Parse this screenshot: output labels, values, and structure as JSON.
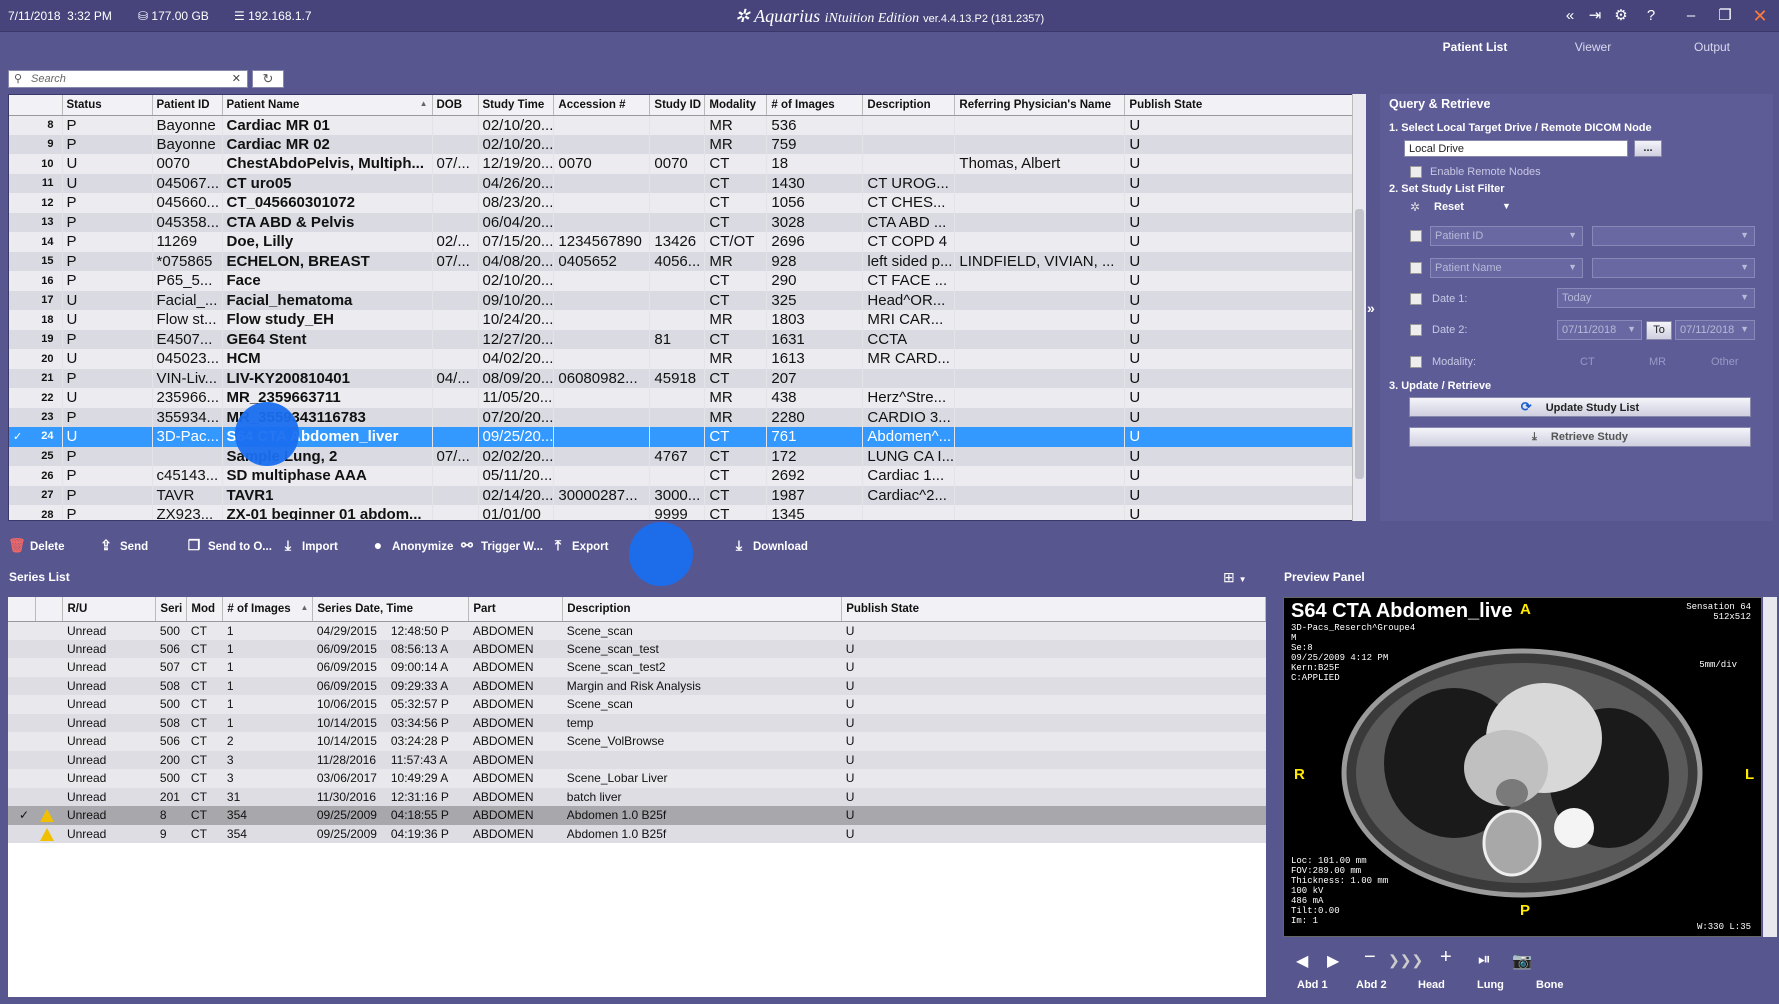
{
  "titlebar": {
    "date": "7/11/2018",
    "time": "3:32 PM",
    "disk": "177.00 GB",
    "ip": "192.168.1.7",
    "app_name": "Aquarius",
    "app_sub": "iNtuition Edition",
    "version": "ver.4.4.13.P2 (181.2357)"
  },
  "nav": {
    "tabs": [
      "Patient List",
      "Viewer",
      "Output"
    ],
    "active": "Patient List"
  },
  "search": {
    "placeholder": "Search"
  },
  "study_table": {
    "columns": [
      "Status",
      "Patient ID",
      "Patient Name",
      "DOB",
      "Study Time",
      "Accession #",
      "Study ID",
      "Modality",
      "# of Images",
      "Description",
      "Referring Physician's Name",
      "Publish State"
    ],
    "rows": [
      {
        "n": "8",
        "status": "P",
        "pid": "Bayonne",
        "name": "Cardiac MR 01",
        "dob": "",
        "time": "02/10/20...",
        "acc": "",
        "sid": "",
        "mod": "MR",
        "img": "536",
        "desc": "",
        "ref": "",
        "pub": "U"
      },
      {
        "n": "9",
        "status": "P",
        "pid": "Bayonne",
        "name": "Cardiac MR 02",
        "dob": "",
        "time": "02/10/20...",
        "acc": "",
        "sid": "",
        "mod": "MR",
        "img": "759",
        "desc": "",
        "ref": "",
        "pub": "U"
      },
      {
        "n": "10",
        "status": "U",
        "pid": "0070",
        "name": "ChestAbdoPelvis, Multiph...",
        "dob": "07/...",
        "time": "12/19/20...",
        "acc": "0070",
        "sid": "0070",
        "mod": "CT",
        "img": "18",
        "desc": "",
        "ref": "Thomas, Albert",
        "pub": "U"
      },
      {
        "n": "11",
        "status": "U",
        "pid": "045067...",
        "name": "CT uro05",
        "dob": "",
        "time": "04/26/20...",
        "acc": "",
        "sid": "",
        "mod": "CT",
        "img": "1430",
        "desc": "CT UROG...",
        "ref": "",
        "pub": "U"
      },
      {
        "n": "12",
        "status": "P",
        "pid": "045660...",
        "name": "CT_045660301072",
        "dob": "",
        "time": "08/23/20...",
        "acc": "",
        "sid": "",
        "mod": "CT",
        "img": "1056",
        "desc": "CT CHES...",
        "ref": "",
        "pub": "U"
      },
      {
        "n": "13",
        "status": "P",
        "pid": "045358...",
        "name": "CTA ABD & Pelvis",
        "dob": "",
        "time": "06/04/20...",
        "acc": "",
        "sid": "",
        "mod": "CT",
        "img": "3028",
        "desc": "CTA ABD ...",
        "ref": "",
        "pub": "U"
      },
      {
        "n": "14",
        "status": "P",
        "pid": "11269",
        "name": "Doe, Lilly",
        "dob": "02/...",
        "time": "07/15/20...",
        "acc": "1234567890",
        "sid": "13426",
        "mod": "CT/OT",
        "img": "2696",
        "desc": "CT COPD 4",
        "ref": "",
        "pub": "U"
      },
      {
        "n": "15",
        "status": "P",
        "pid": "*075865",
        "name": "ECHELON, BREAST",
        "dob": "07/...",
        "time": "04/08/20...",
        "acc": "0405652",
        "sid": "4056...",
        "mod": "MR",
        "img": "928",
        "desc": "left sided p...",
        "ref": "LINDFIELD, VIVIAN, ...",
        "pub": "U"
      },
      {
        "n": "16",
        "status": "P",
        "pid": "P65_5...",
        "name": "Face",
        "dob": "",
        "time": "02/10/20...",
        "acc": "",
        "sid": "",
        "mod": "CT",
        "img": "290",
        "desc": "CT FACE ...",
        "ref": "",
        "pub": "U"
      },
      {
        "n": "17",
        "status": "U",
        "pid": "Facial_...",
        "name": "Facial_hematoma",
        "dob": "",
        "time": "09/10/20...",
        "acc": "",
        "sid": "",
        "mod": "CT",
        "img": "325",
        "desc": "Head^OR...",
        "ref": "",
        "pub": "U"
      },
      {
        "n": "18",
        "status": "U",
        "pid": "Flow st...",
        "name": "Flow study_EH",
        "dob": "",
        "time": "10/24/20...",
        "acc": "",
        "sid": "",
        "mod": "MR",
        "img": "1803",
        "desc": "MRI CAR...",
        "ref": "",
        "pub": "U"
      },
      {
        "n": "19",
        "status": "P",
        "pid": "E4507...",
        "name": "GE64 Stent",
        "dob": "",
        "time": "12/27/20...",
        "acc": "",
        "sid": "81",
        "mod": "CT",
        "img": "1631",
        "desc": "CCTA",
        "ref": "",
        "pub": "U"
      },
      {
        "n": "20",
        "status": "U",
        "pid": "045023...",
        "name": "HCM",
        "dob": "",
        "time": "04/02/20...",
        "acc": "",
        "sid": "",
        "mod": "MR",
        "img": "1613",
        "desc": "MR CARD...",
        "ref": "",
        "pub": "U"
      },
      {
        "n": "21",
        "status": "P",
        "pid": "VIN-Liv...",
        "name": "LIV-KY200810401",
        "dob": "04/...",
        "time": "08/09/20...",
        "acc": "06080982...",
        "sid": "45918",
        "mod": "CT",
        "img": "207",
        "desc": "",
        "ref": "",
        "pub": "U"
      },
      {
        "n": "22",
        "status": "U",
        "pid": "235966...",
        "name": "MR_2359663711",
        "dob": "",
        "time": "11/05/20...",
        "acc": "",
        "sid": "",
        "mod": "MR",
        "img": "438",
        "desc": "Herz^Stre...",
        "ref": "",
        "pub": "U"
      },
      {
        "n": "23",
        "status": "P",
        "pid": "355934...",
        "name": "MR_3559343116783",
        "dob": "",
        "time": "07/20/20...",
        "acc": "",
        "sid": "",
        "mod": "MR",
        "img": "2280",
        "desc": "CARDIO 3...",
        "ref": "",
        "pub": "U"
      },
      {
        "n": "24",
        "status": "U",
        "pid": "3D-Pac...",
        "name": "S64 CTA Abdomen_liver",
        "dob": "",
        "time": "09/25/20...",
        "acc": "",
        "sid": "",
        "mod": "CT",
        "img": "761",
        "desc": "Abdomen^...",
        "ref": "",
        "pub": "U",
        "selected": true
      },
      {
        "n": "25",
        "status": "P",
        "pid": "",
        "name": "Sample Lung, 2",
        "dob": "07/...",
        "time": "02/02/20...",
        "acc": "",
        "sid": "4767",
        "mod": "CT",
        "img": "172",
        "desc": "LUNG CA I...",
        "ref": "",
        "pub": "U"
      },
      {
        "n": "26",
        "status": "P",
        "pid": "c45143...",
        "name": "SD multiphase AAA",
        "dob": "",
        "time": "05/11/20...",
        "acc": "",
        "sid": "",
        "mod": "CT",
        "img": "2692",
        "desc": "Cardiac 1...",
        "ref": "",
        "pub": "U"
      },
      {
        "n": "27",
        "status": "P",
        "pid": "TAVR",
        "name": "TAVR1",
        "dob": "",
        "time": "02/14/20...",
        "acc": "30000287...",
        "sid": "3000...",
        "mod": "CT",
        "img": "1987",
        "desc": "Cardiac^2...",
        "ref": "",
        "pub": "U"
      },
      {
        "n": "28",
        "status": "P",
        "pid": "ZX923...",
        "name": "ZX-01 beginner 01 abdom...",
        "dob": "",
        "time": "01/01/00",
        "acc": "",
        "sid": "9999",
        "mod": "CT",
        "img": "1345",
        "desc": "",
        "ref": "",
        "pub": "U"
      }
    ]
  },
  "toolbar": {
    "delete": "Delete",
    "send": "Send",
    "send_to": "Send to O...",
    "import": "Import",
    "anonymize": "Anonymize",
    "trigger": "Trigger W...",
    "export": "Export",
    "download": "Download"
  },
  "series": {
    "title": "Series List",
    "columns": [
      "R/U",
      "Seri",
      "Mod",
      "# of Images",
      "Series Date, Time",
      "Part",
      "Description",
      "Publish State"
    ],
    "rows": [
      {
        "ru": "Unread",
        "seri": "500",
        "mod": "CT",
        "img": "1",
        "date": "04/29/2015",
        "time": "12:48:50 P",
        "part": "ABDOMEN",
        "desc": "Scene_scan",
        "pub": "U"
      },
      {
        "ru": "Unread",
        "seri": "506",
        "mod": "CT",
        "img": "1",
        "date": "06/09/2015",
        "time": "08:56:13 A",
        "part": "ABDOMEN",
        "desc": "Scene_scan_test",
        "pub": "U"
      },
      {
        "ru": "Unread",
        "seri": "507",
        "mod": "CT",
        "img": "1",
        "date": "06/09/2015",
        "time": "09:00:14 A",
        "part": "ABDOMEN",
        "desc": "Scene_scan_test2",
        "pub": "U"
      },
      {
        "ru": "Unread",
        "seri": "508",
        "mod": "CT",
        "img": "1",
        "date": "06/09/2015",
        "time": "09:29:33 A",
        "part": "ABDOMEN",
        "desc": "Margin and Risk Analysis",
        "pub": "U"
      },
      {
        "ru": "Unread",
        "seri": "500",
        "mod": "CT",
        "img": "1",
        "date": "10/06/2015",
        "time": "05:32:57 P",
        "part": "ABDOMEN",
        "desc": "Scene_scan",
        "pub": "U"
      },
      {
        "ru": "Unread",
        "seri": "508",
        "mod": "CT",
        "img": "1",
        "date": "10/14/2015",
        "time": "03:34:56 P",
        "part": "ABDOMEN",
        "desc": "temp",
        "pub": "U"
      },
      {
        "ru": "Unread",
        "seri": "506",
        "mod": "CT",
        "img": "2",
        "date": "10/14/2015",
        "time": "03:24:28 P",
        "part": "ABDOMEN",
        "desc": "Scene_VolBrowse",
        "pub": "U"
      },
      {
        "ru": "Unread",
        "seri": "200",
        "mod": "CT",
        "img": "3",
        "date": "11/28/2016",
        "time": "11:57:43 A",
        "part": "ABDOMEN",
        "desc": "",
        "pub": "U"
      },
      {
        "ru": "Unread",
        "seri": "500",
        "mod": "CT",
        "img": "3",
        "date": "03/06/2017",
        "time": "10:49:29 A",
        "part": "ABDOMEN",
        "desc": "Scene_Lobar Liver",
        "pub": "U"
      },
      {
        "ru": "Unread",
        "seri": "201",
        "mod": "CT",
        "img": "31",
        "date": "11/30/2016",
        "time": "12:31:16 P",
        "part": "ABDOMEN",
        "desc": "batch liver",
        "pub": "U"
      },
      {
        "ru": "Unread",
        "seri": "8",
        "mod": "CT",
        "img": "354",
        "date": "09/25/2009",
        "time": "04:18:55 P",
        "part": "ABDOMEN",
        "desc": "Abdomen  1.0  B25f",
        "pub": "U",
        "selected": true,
        "warn": true
      },
      {
        "ru": "Unread",
        "seri": "9",
        "mod": "CT",
        "img": "354",
        "date": "09/25/2009",
        "time": "04:19:36 P",
        "part": "ABDOMEN",
        "desc": "Abdomen  1.0  B25f",
        "pub": "U",
        "warn": true
      }
    ]
  },
  "query": {
    "title": "Query & Retrieve",
    "step1": "1. Select Local Target Drive / Remote DICOM Node",
    "drive": "Local Drive",
    "browse": "...",
    "enable_remote": "Enable Remote Nodes",
    "step2": "2. Set Study List Filter",
    "reset": "Reset",
    "f_pid": "Patient ID",
    "f_pname": "Patient Name",
    "date1_label": "Date 1:",
    "date1_val": "Today",
    "date2_label": "Date 2:",
    "date2_from": "07/11/2018",
    "to": "To",
    "date2_to": "07/11/2018",
    "modality_label": "Modality:",
    "mods": [
      "CT",
      "MR",
      "Other"
    ],
    "step3": "3. Update / Retrieve",
    "update": "Update Study List",
    "retrieve": "Retrieve Study"
  },
  "preview": {
    "title": "Preview Panel",
    "name": "S64 CTA Abdomen_live",
    "info": "3D-Pacs_Reserch^Groupe4\nM\nSe:8\n09/25/2009 4:12 PM\nKern:B25F\nC:APPLIED",
    "scanner": "Sensation 64\n512x512",
    "scale": "5mm/div",
    "bottom_info": "Loc: 101.00 mm\nFOV:289.00 mm\nThickness: 1.00 mm\n100 kV\n486 mA\nTilt:0.00\nIm: 1",
    "wl": "W:330 L:35",
    "or_top": "A",
    "or_bottom": "P",
    "or_left": "R",
    "or_right": "L",
    "presets": [
      "Abd 1",
      "Abd 2",
      "Head",
      "Lung",
      "Bone"
    ]
  }
}
